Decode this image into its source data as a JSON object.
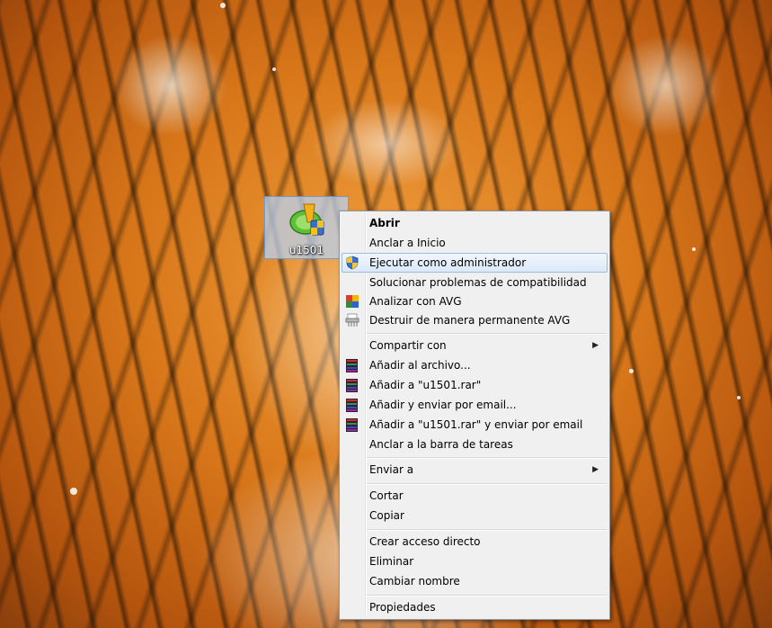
{
  "desktop": {
    "icon": {
      "label": "u1501",
      "icon_name": "installer-app-icon"
    }
  },
  "context_menu": {
    "items": {
      "abrir": "Abrir",
      "anclar_inicio": "Anclar a Inicio",
      "ejecutar_admin": "Ejecutar como administrador",
      "solucionar": "Solucionar problemas de compatibilidad",
      "analizar_avg": "Analizar con AVG",
      "destruir_avg": "Destruir de manera permanente AVG",
      "compartir": "Compartir con",
      "anadir_archivo": "Añadir al archivo...",
      "anadir_rar": "Añadir a \"u1501.rar\"",
      "anadir_email": "Añadir y enviar por email...",
      "anadir_rar_email": "Añadir a \"u1501.rar\" y enviar por email",
      "anclar_barra": "Anclar a la barra de tareas",
      "enviar_a": "Enviar a",
      "cortar": "Cortar",
      "copiar": "Copiar",
      "crear_acceso": "Crear acceso directo",
      "eliminar": "Eliminar",
      "cambiar_nombre": "Cambiar nombre",
      "propiedades": "Propiedades"
    },
    "highlighted_item": "Ejecutar como administrador",
    "icons": {
      "ejecutar_admin": "uac-shield-icon",
      "analizar_avg": "avg-icon",
      "destruir_avg": "shredder-icon",
      "winrar": "winrar-icon",
      "submenu": "chevron-right-icon"
    },
    "colors": {
      "menu_background": "#f0f0f0",
      "highlight_background": "#dde9f8",
      "highlight_border": "#9bbbe3"
    }
  }
}
